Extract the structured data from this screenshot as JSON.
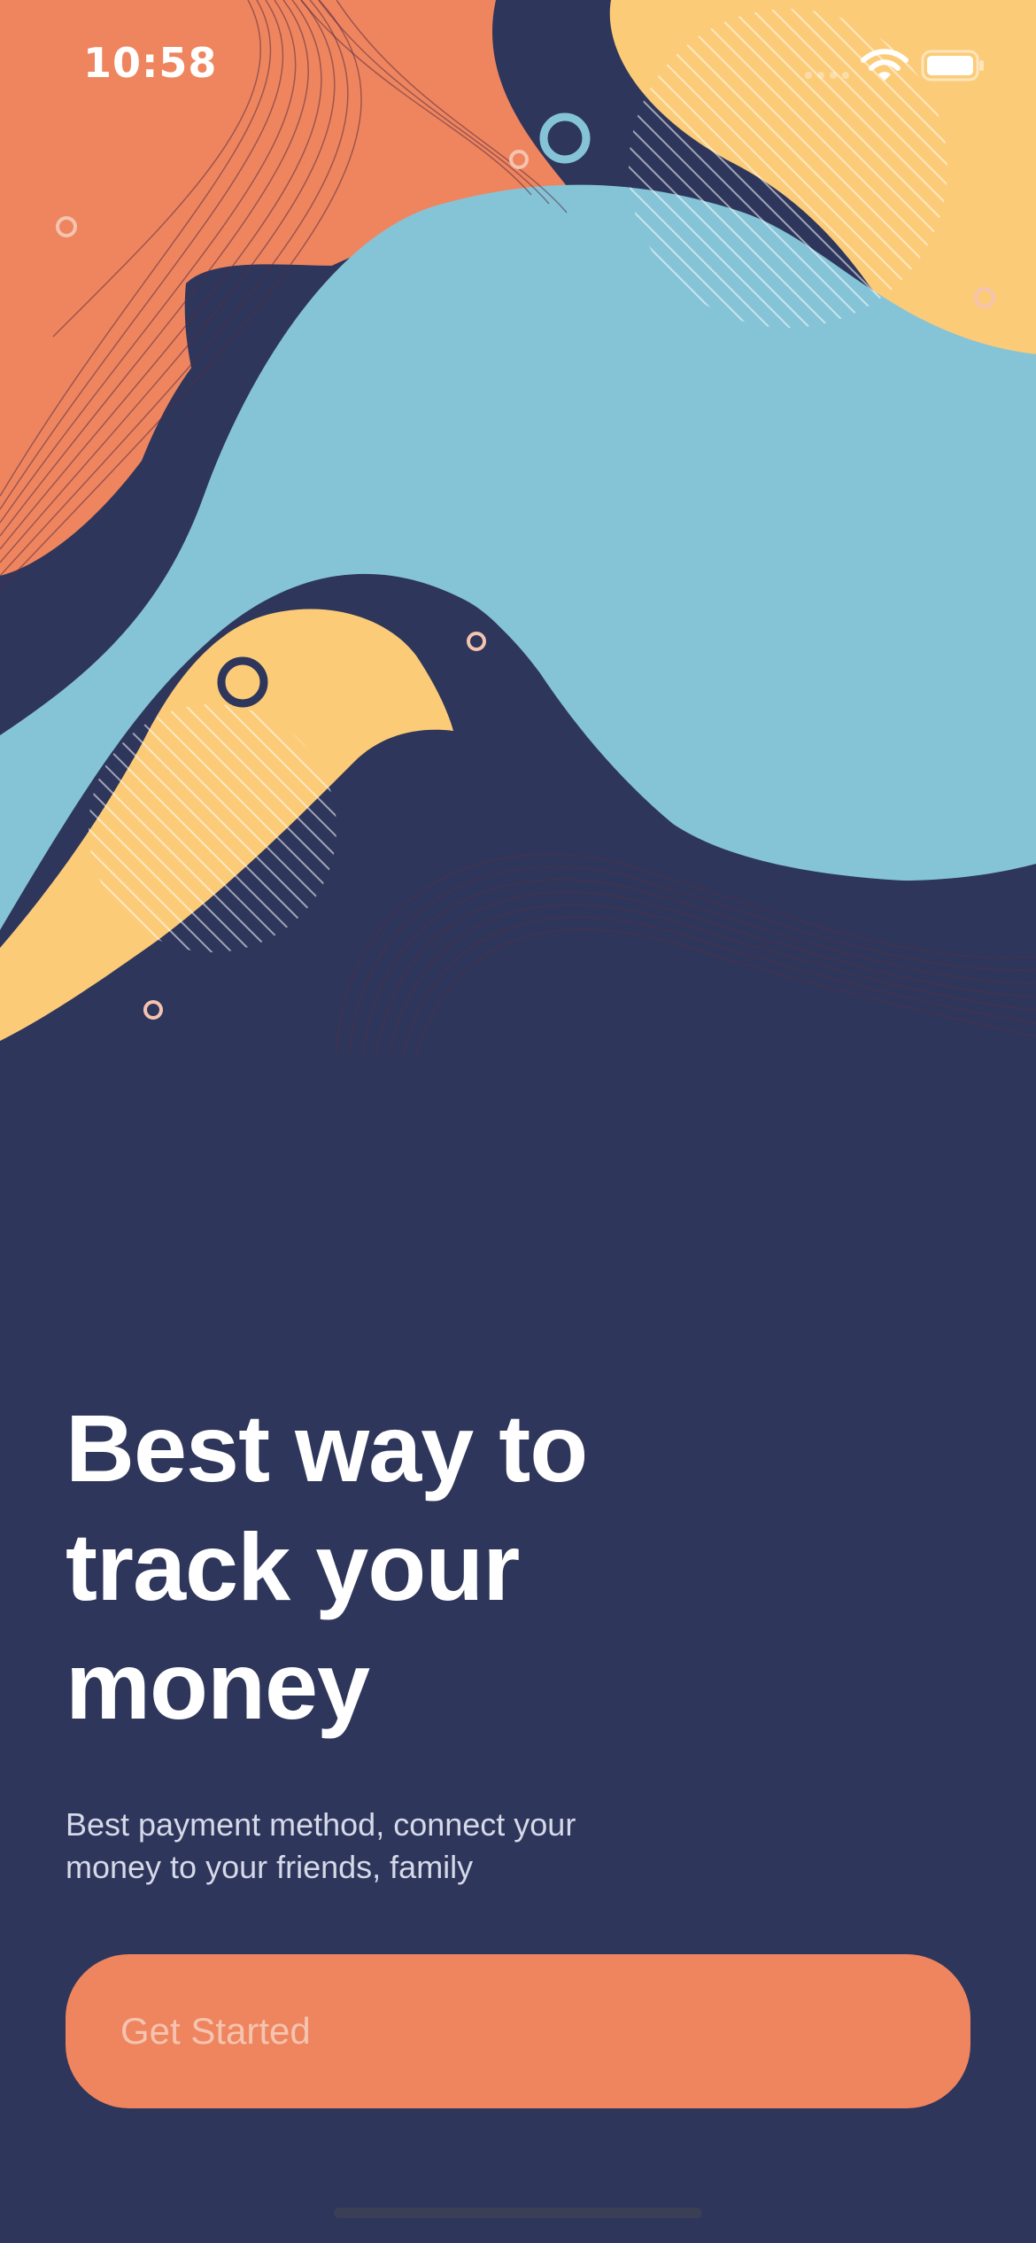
{
  "status_bar": {
    "time": "10:58",
    "icons": [
      "signal-icon",
      "wifi-icon",
      "battery-icon"
    ]
  },
  "onboarding": {
    "headline": "Best way to\ntrack your\nmoney",
    "subtitle": "Best payment method, connect your\nmoney to your friends, family",
    "cta_label": "Get Started"
  },
  "colors": {
    "background": "#2e365b",
    "orange": "#ef855e",
    "yellow": "#fccb78",
    "light_blue": "#85c4d7",
    "navy": "#2e365b"
  }
}
